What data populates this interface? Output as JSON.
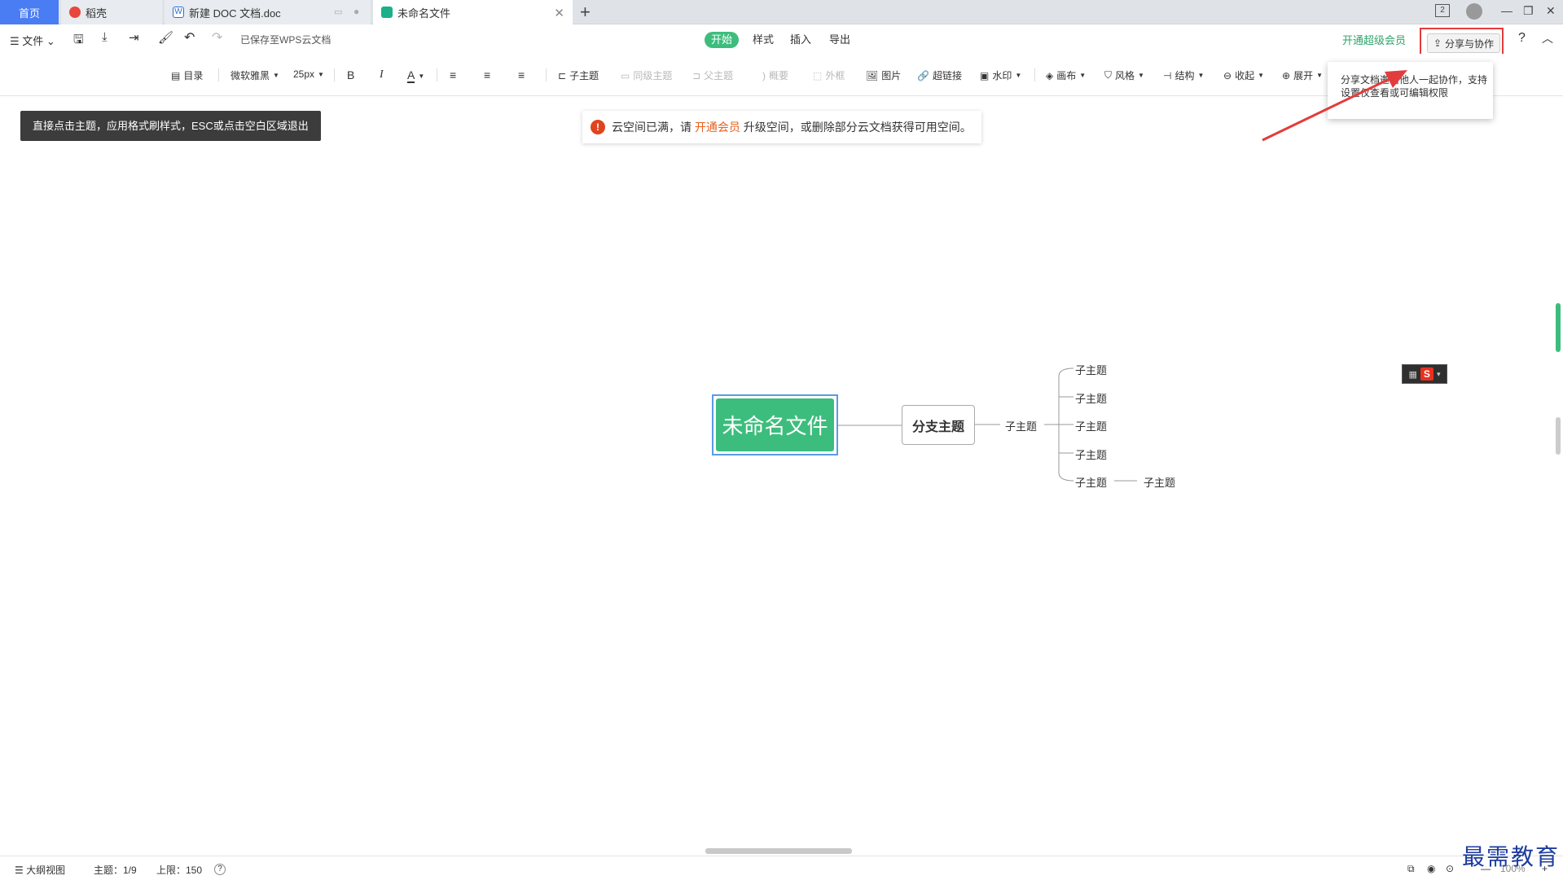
{
  "tabs": [
    {
      "label": "首页"
    },
    {
      "label": "稻壳"
    },
    {
      "label": "新建 DOC 文档.doc"
    },
    {
      "label": "未命名文件"
    }
  ],
  "window": {
    "badge": "2"
  },
  "menu": {
    "file": "文件",
    "saved_status": "已保存至WPS云文档",
    "ribbon_tabs": [
      "开始",
      "样式",
      "插入",
      "导出"
    ],
    "vip_link": "开通超级会员",
    "share_button": "分享与协作",
    "help": "?"
  },
  "toolbar": {
    "outline": "目录",
    "font_family": "微软雅黑",
    "font_size": "25px",
    "bold": "B",
    "italic": "I",
    "font_color": "A",
    "child_topic": "子主题",
    "sibling_topic": "同级主题",
    "parent_topic": "父主题",
    "summary": "概要",
    "frame": "外框",
    "image": "图片",
    "hyperlink": "超链接",
    "watermark": "水印",
    "canvas": "画布",
    "style": "风格",
    "structure": "结构",
    "collapse": "收起",
    "expand": "展开"
  },
  "tooltip": {
    "line1": "分享文档邀请他人一起协作，支持",
    "line2": "设置仅查看或可编辑权限"
  },
  "hint": "直接点击主题，应用格式刷样式，ESC或点击空白区域退出",
  "notice": {
    "before": "云空间已满，请",
    "link": "开通会员",
    "after": "升级空间，或删除部分云文档获得可用空间。"
  },
  "mindmap": {
    "root": "未命名文件",
    "branch": "分支主题",
    "level2": "子主题",
    "level3": [
      "子主题",
      "子主题",
      "子主题",
      "子主题",
      "子主题"
    ],
    "level4": "子主题"
  },
  "status": {
    "outline_view": "大纲视图",
    "topic_count": "主题：1/9",
    "limit": "上限：150",
    "zoom": "100%"
  },
  "watermark_text": "最需教育",
  "colors": {
    "accent": "#3dbd7d",
    "highlight": "#e23c3c",
    "tab_home": "#4a7cf3"
  }
}
